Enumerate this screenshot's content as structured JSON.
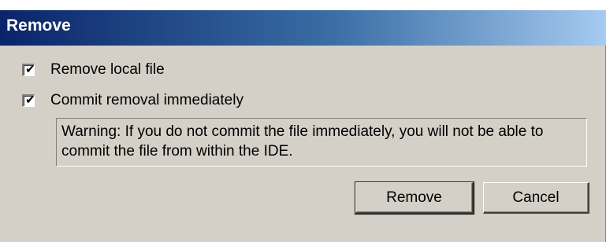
{
  "window": {
    "title": "Remove"
  },
  "options": {
    "remove_local": {
      "label": "Remove local file",
      "checked": true
    },
    "commit_now": {
      "label": "Commit removal immediately",
      "checked": true
    }
  },
  "warning": {
    "text": "Warning: If you do not commit the file immediately, you will not be able to commit the file from within the IDE."
  },
  "buttons": {
    "remove": "Remove",
    "cancel": "Cancel"
  },
  "colors": {
    "title_gradient_start": "#0a246a",
    "title_gradient_end": "#a6caf0",
    "dialog_bg": "#d4d0c8"
  }
}
